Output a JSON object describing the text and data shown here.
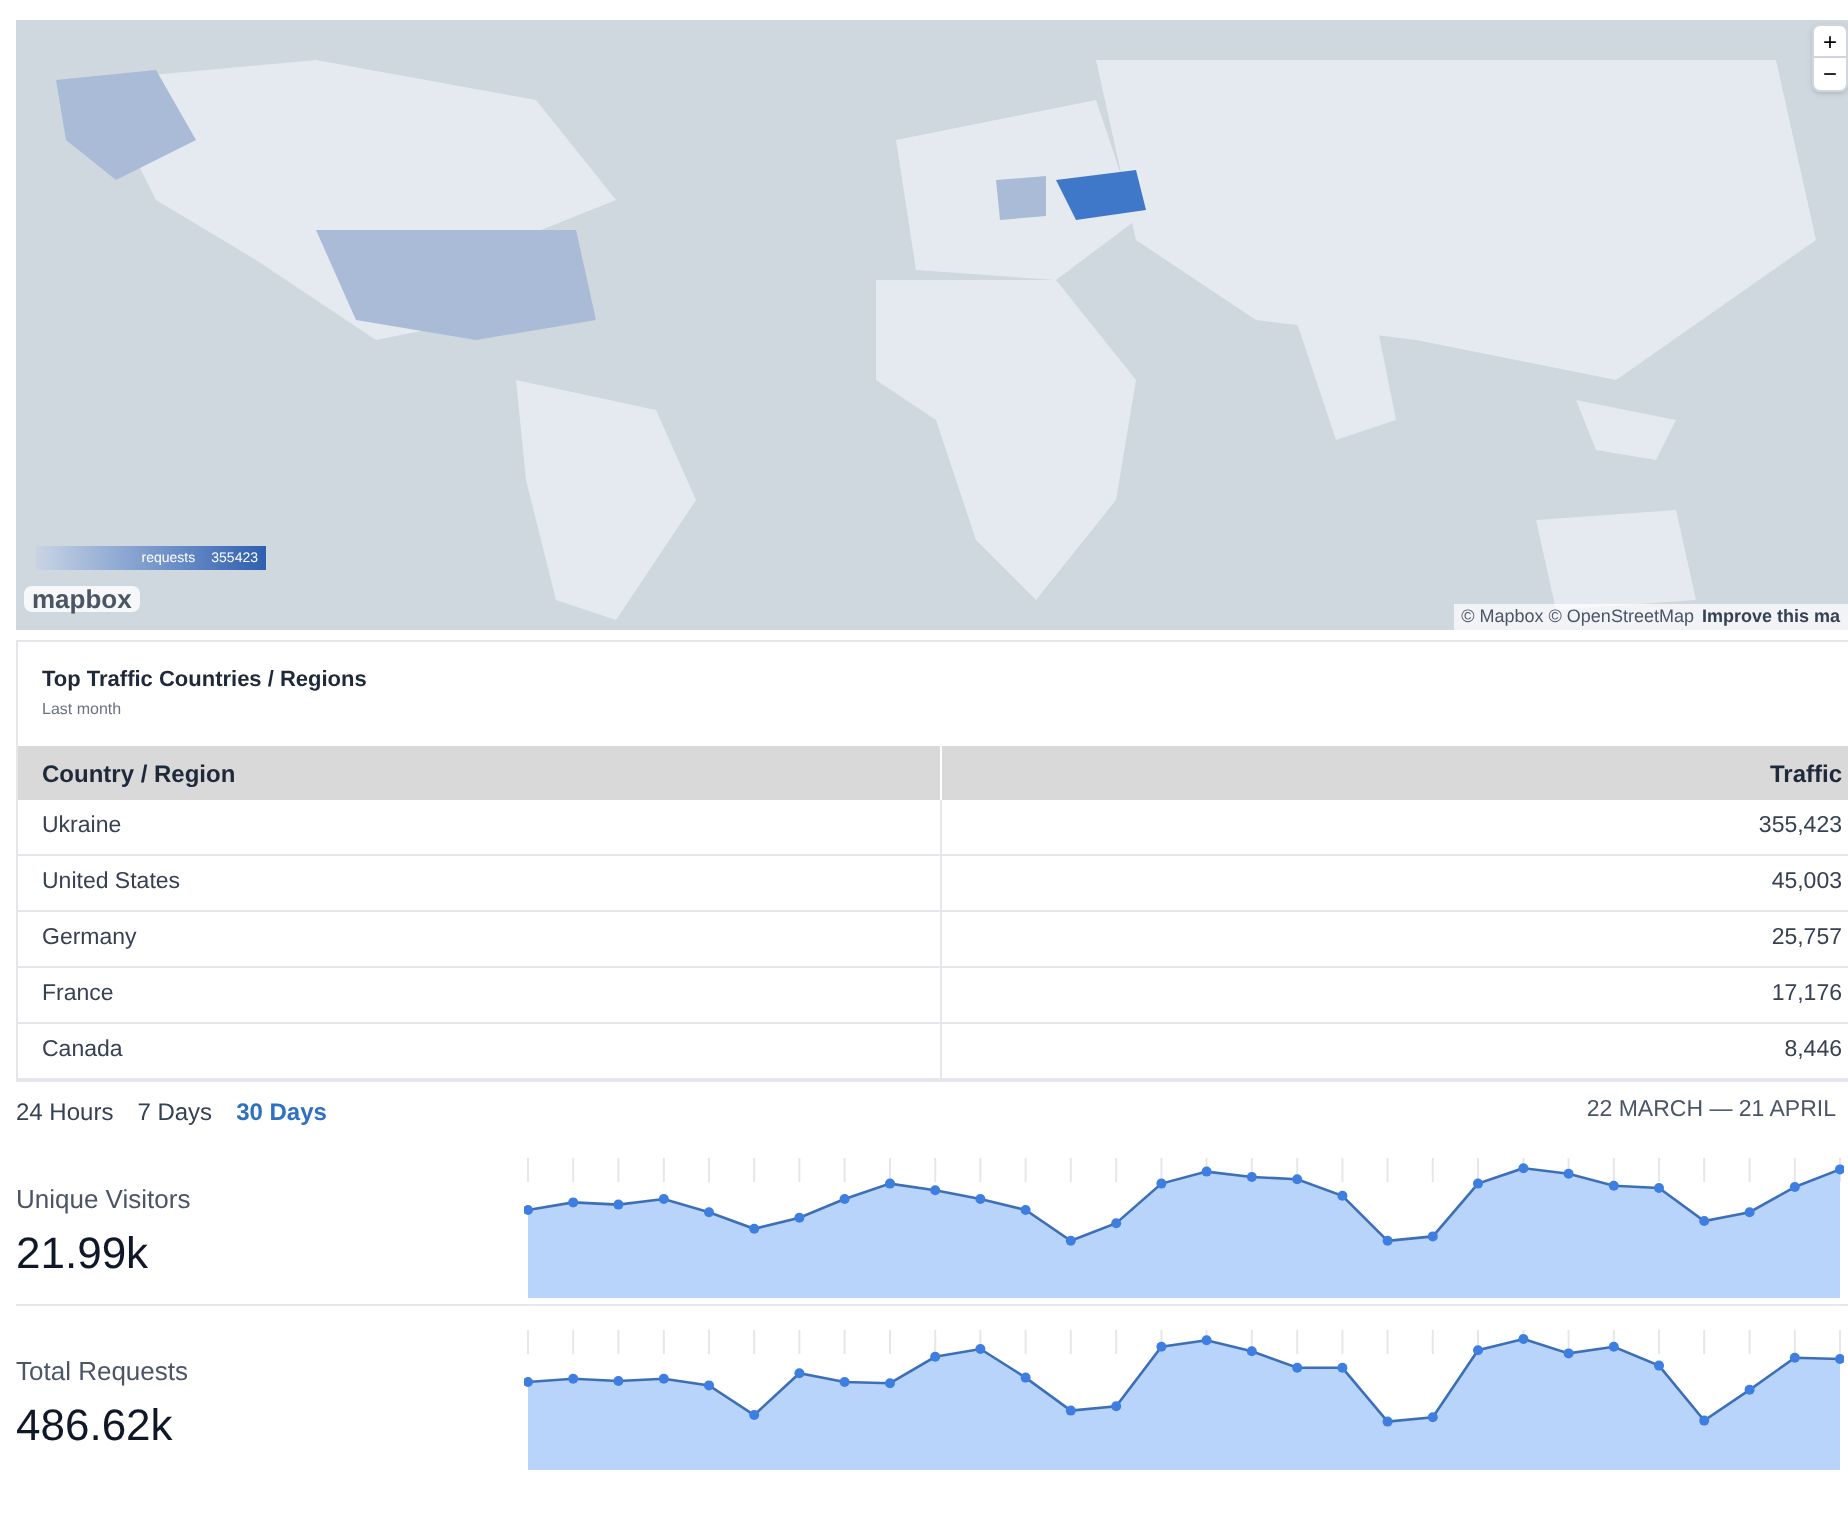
{
  "map": {
    "kind": "picture",
    "zoom_in": "+",
    "zoom_out": "−",
    "legend": {
      "label": "requests",
      "max": "355423"
    },
    "logo": "mapbox",
    "attribution": "© Mapbox © OpenStreetMap",
    "improve_link": "Improve this ma"
  },
  "top_traffic": {
    "title": "Top Traffic Countries / Regions",
    "subtitle": "Last month",
    "columns": [
      "Country / Region",
      "Traffic"
    ],
    "rows": [
      {
        "country": "Ukraine",
        "traffic": "355,423"
      },
      {
        "country": "United States",
        "traffic": "45,003"
      },
      {
        "country": "Germany",
        "traffic": "25,757"
      },
      {
        "country": "France",
        "traffic": "17,176"
      },
      {
        "country": "Canada",
        "traffic": "8,446"
      }
    ]
  },
  "ranges": [
    {
      "label": "24 Hours",
      "selected": false
    },
    {
      "label": "7 Days",
      "selected": false
    },
    {
      "label": "30 Days",
      "selected": true
    }
  ],
  "date_range": "22 MARCH — 21 APRIL",
  "stats": [
    {
      "label": "Unique Visitors",
      "value": "21.99k"
    },
    {
      "label": "Total Requests",
      "value": "486.62k"
    }
  ]
}
